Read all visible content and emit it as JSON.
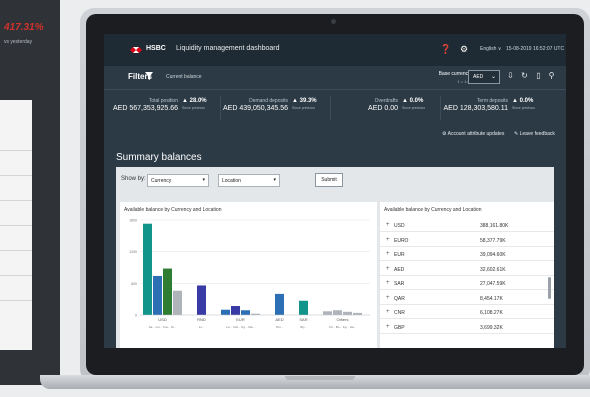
{
  "background_device": {
    "figure": "417.31%",
    "subtext": "vs yesterday"
  },
  "app": {
    "brand": "HSBC",
    "title": "Liquidity management dashboard",
    "language": "English ∨",
    "timestamp": "15-08-2019 16:52:07 UTC",
    "colors": {
      "brand_red": "#db0011",
      "header_bg": "#1f2b34",
      "body_bg": "#2c3a45"
    }
  },
  "filters": {
    "label": "Filters",
    "current": "Current balance",
    "base_currency_label": "Base currency:",
    "base_currency_unit": "1 = 1.00",
    "currency_value": "AED"
  },
  "kpis": [
    {
      "label": "Total position",
      "value": "AED 567,353,925.66",
      "change": "▲ 28.0%",
      "change_sub": "Since previous"
    },
    {
      "label": "Demand deposits",
      "value": "AED 439,050,345.56",
      "change": "▲ 39.3%",
      "change_sub": "Since previous"
    },
    {
      "label": "Overdrafts",
      "value": "AED 0.00",
      "change": "▲ 0.0%",
      "change_sub": "Since previous"
    },
    {
      "label": "Term deposits",
      "value": "AED 128,303,580.11",
      "change": "▲ 0.0%",
      "change_sub": "Since previous"
    }
  ],
  "links": {
    "account_attr": "Account attribute updates",
    "feedback": "Leave feedback"
  },
  "summary": {
    "title": "Summary balances",
    "show_by_label": "Show by:",
    "show_by_value": "Currency",
    "location_value": "Location",
    "submit_label": "Submit"
  },
  "chart_data": {
    "type": "bar",
    "title": "Available balance by Currency and Location",
    "yticks": [
      "1800",
      "1200",
      "600",
      "0"
    ],
    "ylim": [
      0,
      1800
    ],
    "groups": [
      {
        "label": "USD",
        "sub": "Sa...  Lvi...  Cra...  Oi...",
        "bars": [
          {
            "v": 1730,
            "c": "#11958b"
          },
          {
            "v": 740,
            "c": "#2d6fb4"
          },
          {
            "v": 880,
            "c": "#2e7d32"
          },
          {
            "v": 460,
            "c": "#aeb4b9"
          }
        ]
      },
      {
        "label": "RND",
        "sub": "Lv...",
        "bars": [
          {
            "v": 560,
            "c": "#3a3aa6"
          }
        ]
      },
      {
        "label": "EUR",
        "sub": "Lvi...  Gdi...  Kg...  Ma...",
        "bars": [
          {
            "v": 100,
            "c": "#2d6fb4"
          },
          {
            "v": 170,
            "c": "#3a3aa6"
          },
          {
            "v": 90,
            "c": "#2d6fb4"
          },
          {
            "v": 25,
            "c": "#aeb4b9"
          }
        ]
      },
      {
        "label": "AED",
        "sub": "Dxi...",
        "bars": [
          {
            "v": 400,
            "c": "#2d6fb4"
          }
        ]
      },
      {
        "label": "SAR",
        "sub": "Rly...",
        "bars": [
          {
            "v": 270,
            "c": "#11958b"
          }
        ]
      },
      {
        "label": "Others",
        "sub": "Cli...  Bu...  Kg...  Ha...",
        "bars": [
          {
            "v": 70,
            "c": "#aeb4b9"
          },
          {
            "v": 90,
            "c": "#aeb4b9"
          },
          {
            "v": 60,
            "c": "#aeb4b9"
          },
          {
            "v": 40,
            "c": "#aeb4b9"
          }
        ]
      }
    ]
  },
  "list": {
    "title": "Available balance by Currency and Location",
    "rows": [
      {
        "code": "USD",
        "value": "388,161.80K"
      },
      {
        "code": "EURO",
        "value": "58,377.79K"
      },
      {
        "code": "EUR",
        "value": "39,094.60K"
      },
      {
        "code": "AED",
        "value": "32,602.61K"
      },
      {
        "code": "SAR",
        "value": "27,047.59K"
      },
      {
        "code": "QAR",
        "value": "8,454.17K"
      },
      {
        "code": "CNR",
        "value": "6,108.27K"
      },
      {
        "code": "GBP",
        "value": "3,699.32K"
      }
    ]
  }
}
